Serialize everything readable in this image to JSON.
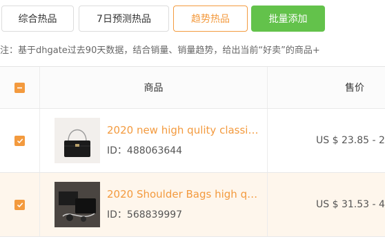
{
  "toolbar": {
    "overall_label": "综合热品",
    "forecast_label": "7日预测热品",
    "trend_label": "趋势热品",
    "batch_add_label": "批量添加"
  },
  "note": "注：基于dhgate过去90天数据，结合销量、销量趋势，给出当前“好卖”的商品+",
  "table": {
    "headers": {
      "product": "商品",
      "price": "售价"
    },
    "rows": [
      {
        "title": "2020 new high qulity classic…",
        "id": "ID：488063644",
        "price": "US $ 23.85 - 2",
        "checked": true
      },
      {
        "title": "2020 Shoulder Bags high q…",
        "id": "ID：568839997",
        "price": "US $ 31.53 - 4",
        "checked": true
      }
    ]
  },
  "colors": {
    "accent_orange": "#f39a3e",
    "batch_green": "#63c24b",
    "row_highlight": "#fef6ec"
  }
}
